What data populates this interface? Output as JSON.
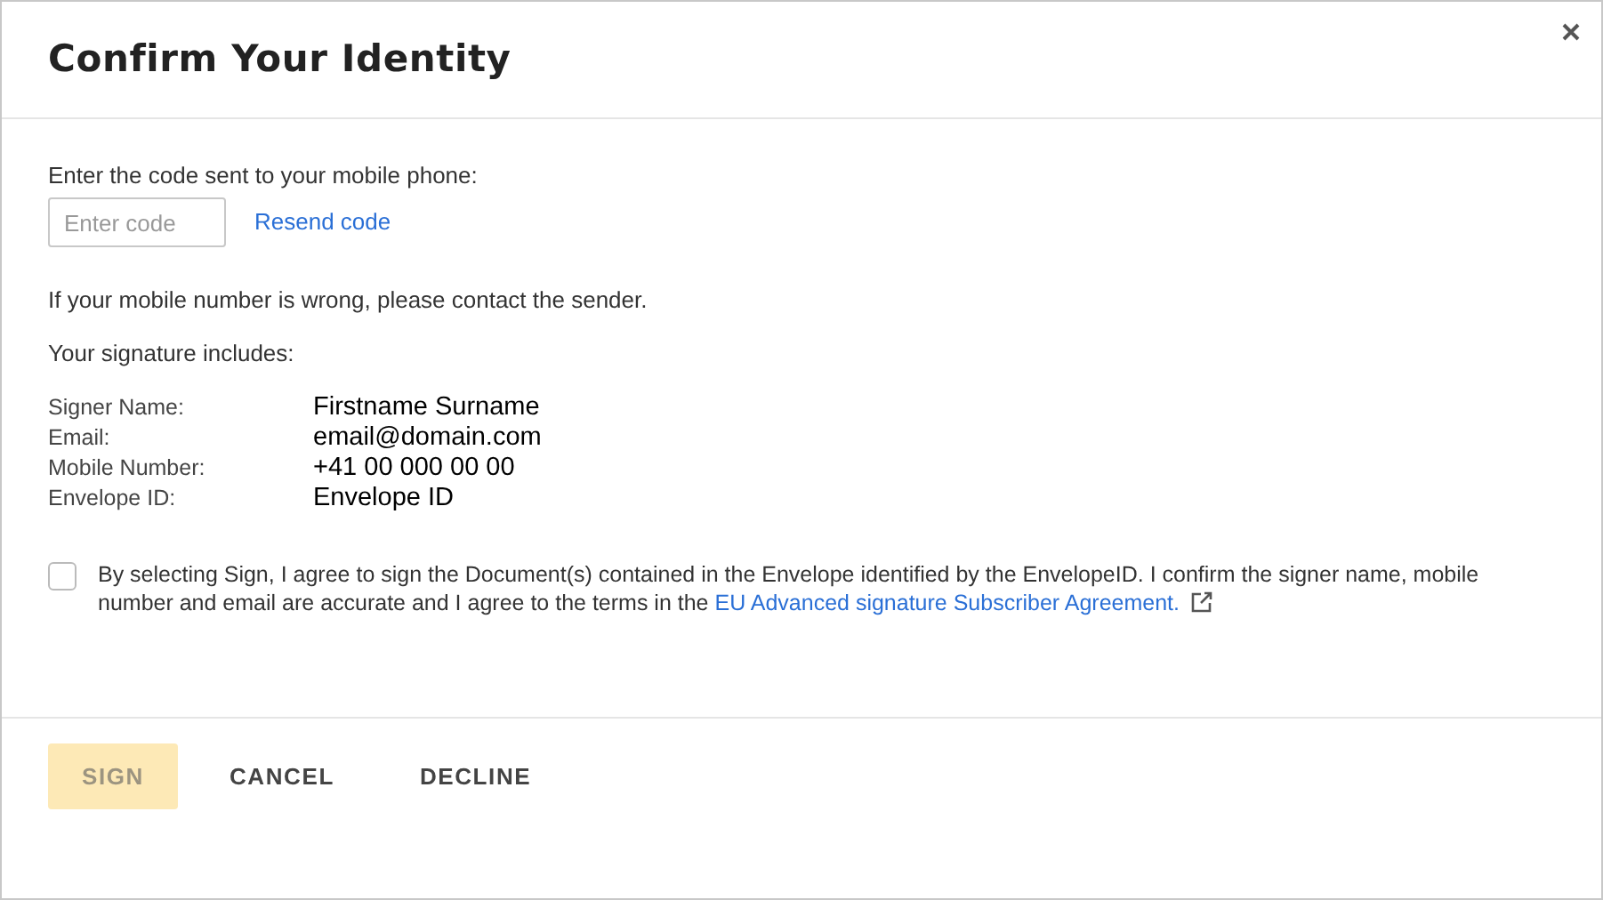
{
  "dialog": {
    "title": "Confirm Your Identity"
  },
  "code_prompt": "Enter the code sent to your mobile phone:",
  "code_field": {
    "placeholder": "Enter code"
  },
  "resend_link": "Resend code",
  "wrong_number_note": "If your mobile number is wrong, please contact the sender.",
  "signature_heading": "Your signature includes:",
  "details": [
    {
      "label": "Signer Name:",
      "value": "Firstname Surname"
    },
    {
      "label": "Email:",
      "value": "email@domain.com"
    },
    {
      "label": "Mobile Number:",
      "value": "+41 00 000 00 00"
    },
    {
      "label": "Envelope ID:",
      "value": "Envelope ID"
    }
  ],
  "agreement": {
    "checked": false,
    "text": "By selecting Sign, I agree to sign the Document(s) contained in the Envelope identified by the EnvelopeID. I confirm the signer name, mobile number and email are accurate and I agree to the terms in the",
    "link": "EU Advanced signature Subscriber Agreement."
  },
  "buttons": [
    {
      "label": "SIGN",
      "kind": "primary",
      "disabled": true
    },
    {
      "label": "CANCEL",
      "kind": "text",
      "disabled": false
    },
    {
      "label": "DECLINE",
      "kind": "text",
      "disabled": false
    }
  ]
}
